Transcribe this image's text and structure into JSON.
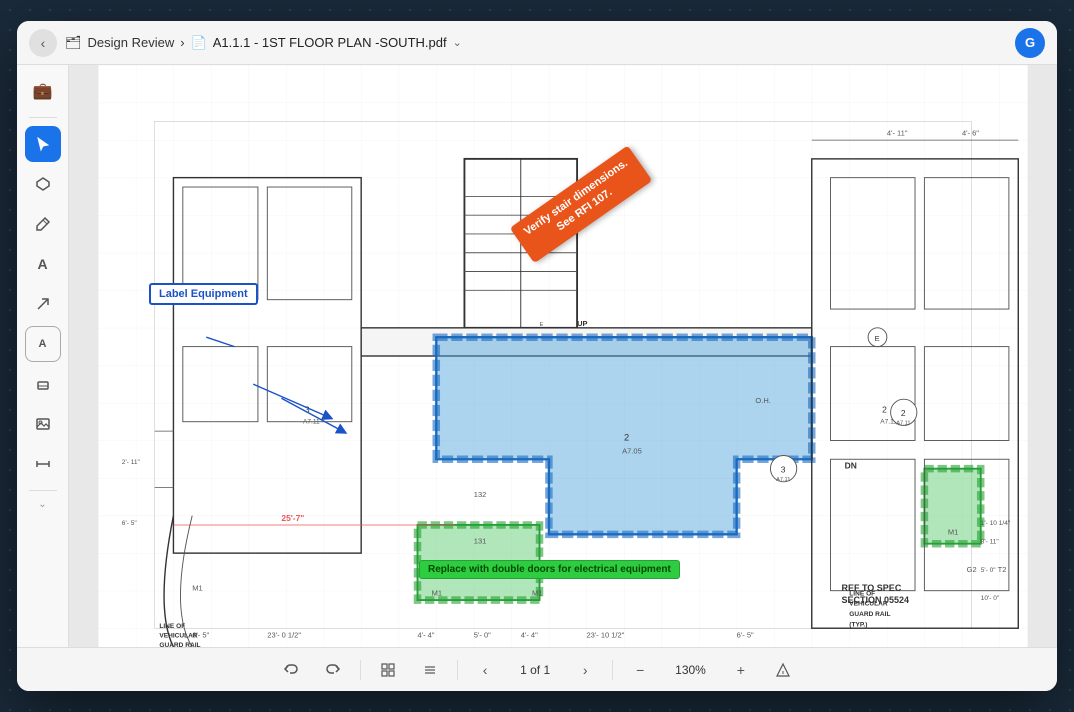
{
  "header": {
    "back_label": "‹",
    "breadcrumb_icon": "🗂",
    "breadcrumb_parent": "Design Review",
    "separator": "›",
    "doc_icon": "📄",
    "title": "A1.1.1 - 1ST FLOOR PLAN -SOUTH.pdf",
    "chevron": "⌄",
    "avatar_initial": "G"
  },
  "toolbar": {
    "tools": [
      {
        "id": "briefcase",
        "icon": "💼",
        "active": false
      },
      {
        "id": "cursor",
        "icon": "↖",
        "active": true
      },
      {
        "id": "polygon",
        "icon": "⬡",
        "active": false
      },
      {
        "id": "pen",
        "icon": "✏",
        "active": false
      },
      {
        "id": "text",
        "icon": "A",
        "active": false
      },
      {
        "id": "arrow",
        "icon": "↗",
        "active": false
      },
      {
        "id": "label-a",
        "icon": "A",
        "active": false
      },
      {
        "id": "eraser",
        "icon": "◻",
        "active": false
      },
      {
        "id": "image",
        "icon": "🖼",
        "active": false
      },
      {
        "id": "measure",
        "icon": "↔",
        "active": false
      }
    ],
    "expand_icon": "⌄"
  },
  "annotations": {
    "orange_text_line1": "Verify stair dimensions.",
    "orange_text_line2": "See RFI 107.",
    "blue_label": "Label Equipment",
    "green_bottom": "Replace with double doors for electrical equipment",
    "ref_to_spec_line1": "REF TO SPEC",
    "ref_to_spec_line2": "SECTION 05524"
  },
  "bottom_bar": {
    "undo_label": "↩",
    "redo_label": "↪",
    "grid_label": "⊞",
    "list_label": "≡",
    "prev_page": "‹",
    "page_indicator": "1 of 1",
    "next_page": "›",
    "zoom_minus": "−",
    "zoom_level": "130%",
    "zoom_plus": "+",
    "measure_icon": "📐"
  },
  "colors": {
    "blue_fill": "rgba(70, 160, 220, 0.45)",
    "blue_stroke": "#1a6abf",
    "green_fill": "rgba(80, 200, 100, 0.45)",
    "green_stroke": "#27a035",
    "orange_bg": "#e8541a",
    "label_blue": "#1a52c8"
  }
}
